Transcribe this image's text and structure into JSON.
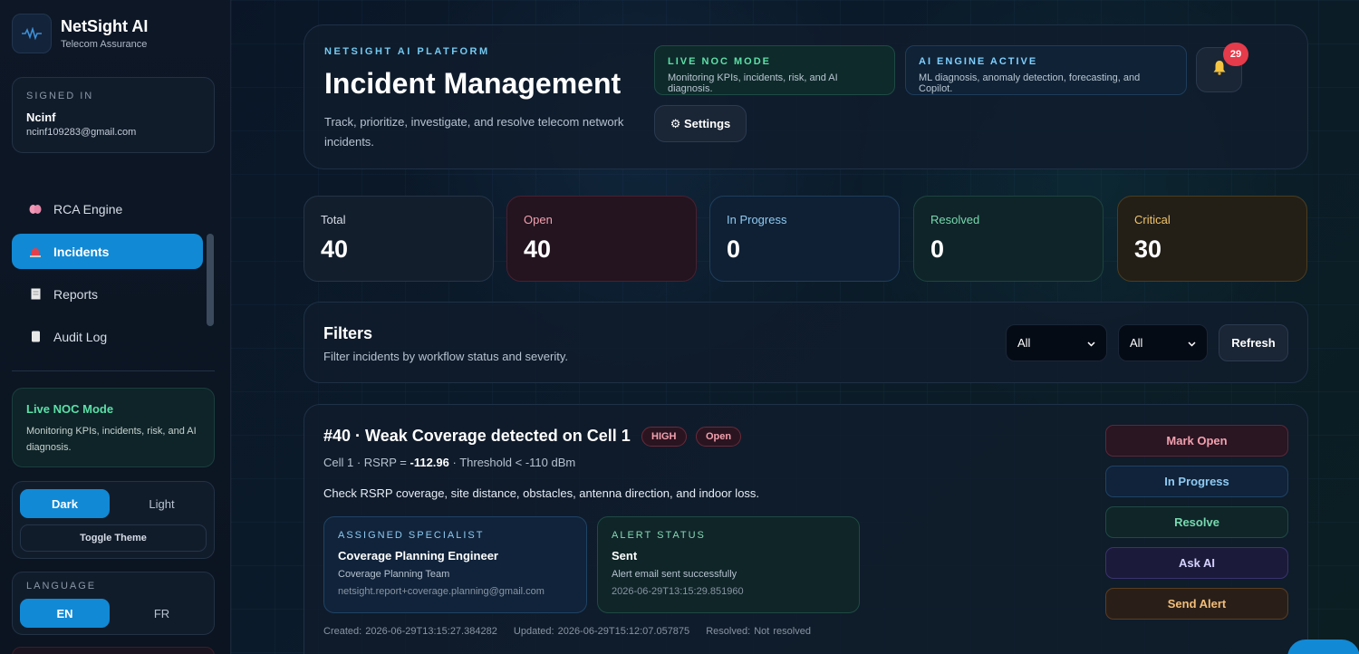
{
  "brand": {
    "title": "NetSight AI",
    "subtitle": "Telecom Assurance"
  },
  "signed_in": {
    "label": "SIGNED IN",
    "name": "Ncinf",
    "email": "ncinf109283@gmail.com"
  },
  "nav": {
    "items": [
      {
        "label": "RCA Engine",
        "icon": "brain-icon",
        "active": false
      },
      {
        "label": "Incidents",
        "icon": "siren-icon",
        "active": true
      },
      {
        "label": "Reports",
        "icon": "document-icon",
        "active": false
      },
      {
        "label": "Audit Log",
        "icon": "scroll-icon",
        "active": false
      }
    ]
  },
  "sidebar_noc": {
    "title": "Live NOC Mode",
    "desc": "Monitoring KPIs, incidents, risk, and AI diagnosis."
  },
  "theme": {
    "dark": "Dark",
    "light": "Light",
    "toggle": "Toggle Theme",
    "selected": "Dark"
  },
  "language": {
    "label": "LANGUAGE",
    "en": "EN",
    "fr": "FR",
    "selected": "EN"
  },
  "header": {
    "kicker": "NETSIGHT AI PLATFORM",
    "title": "Incident Management",
    "desc": "Track, prioritize, investigate, and resolve telecom network incidents.",
    "live_chip": {
      "title": "LIVE NOC MODE",
      "desc": "Monitoring KPIs, incidents, risk, and AI diagnosis."
    },
    "ai_chip": {
      "title": "AI ENGINE ACTIVE",
      "desc": "ML diagnosis, anomaly detection, forecasting, and Copilot."
    },
    "notifications": "29",
    "settings": "⚙ Settings"
  },
  "stats": [
    {
      "label": "Total",
      "value": "40"
    },
    {
      "label": "Open",
      "value": "40"
    },
    {
      "label": "In Progress",
      "value": "0"
    },
    {
      "label": "Resolved",
      "value": "0"
    },
    {
      "label": "Critical",
      "value": "30"
    }
  ],
  "filters": {
    "title": "Filters",
    "desc": "Filter incidents by workflow status and severity.",
    "status_value": "All",
    "severity_value": "All",
    "refresh": "Refresh"
  },
  "incident": {
    "title": "#40 · Weak Coverage detected on Cell 1",
    "severity": "HIGH",
    "status": "Open",
    "metric_prefix": "Cell 1 · RSRP = ",
    "metric_value": "-112.96",
    "metric_suffix": " · Threshold < -110 dBm",
    "action": "Check RSRP coverage, site distance, obstacles, antenna direction, and indoor loss.",
    "specialist": {
      "label": "ASSIGNED SPECIALIST",
      "role": "Coverage Planning Engineer",
      "team": "Coverage Planning Team",
      "email": "netsight.report+coverage.planning@gmail.com"
    },
    "alert": {
      "label": "ALERT STATUS",
      "status": "Sent",
      "message": "Alert email sent successfully",
      "time": "2026-06-29T13:15:29.851960"
    },
    "created": "Created: 2026-06-29T13:15:27.384282",
    "updated": "Updated: 2026-06-29T15:12:07.057875",
    "resolved": "Resolved: Not resolved",
    "actions": {
      "mark_open": "Mark Open",
      "in_progress": "In Progress",
      "resolve": "Resolve",
      "ask_ai": "Ask AI",
      "send_alert": "Send Alert"
    }
  },
  "colors": {
    "accent": "#1289d4",
    "open": "#f3a0ae",
    "progress": "#8fcaf2",
    "resolved": "#77d8ae",
    "critical": "#f0c46a",
    "badge_red": "#e53b4a"
  }
}
